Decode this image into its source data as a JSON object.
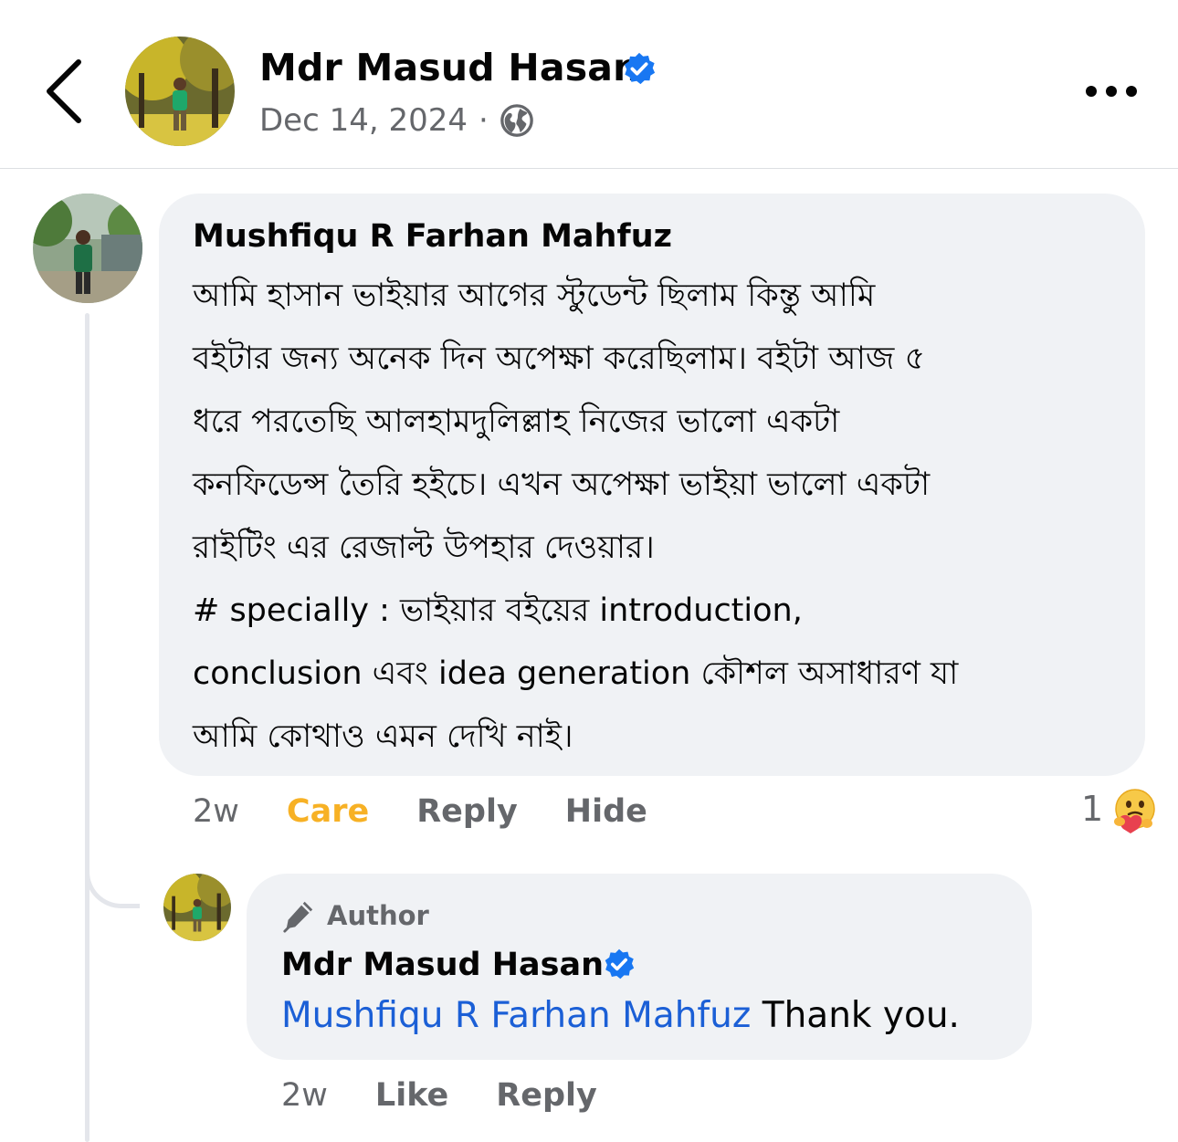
{
  "header": {
    "back_icon": "chevron-left-icon",
    "poster_name": "Mdr Masud Hasan",
    "verified_icon": "verified-badge-icon",
    "post_date": "Dec 14, 2024",
    "separator": "·",
    "privacy_icon": "globe-icon",
    "more_icon": "more-horizontal-icon"
  },
  "comment": {
    "author": "Mushfiqu R Farhan Mahfuz",
    "lines": [
      "আমি হাসান ভাইয়ার আগের স্টুডেন্ট ছিলাম কিন্তু আমি",
      "বইটার জন্য অনেক দিন অপেক্ষা করেছিলাম। বইটা আজ ৫",
      "ধরে পরতেছি আলহামদুলিল্লাহ নিজের ভালো একটা",
      "কনফিডেন্স তৈরি হইচে। এখন অপেক্ষা ভাইয়া ভালো একটা",
      "রাইটিং এর রেজাল্ট উপহার দেওয়ার।",
      "# specially : ভাইয়ার বইয়ের introduction,",
      "conclusion এবং idea generation কৌশল অসাধারণ যা",
      "আমি কোথাও এমন দেখি নাই।"
    ],
    "time": "2w",
    "reaction_label": "Care",
    "reply_label": "Reply",
    "hide_label": "Hide",
    "reaction_count": "1",
    "reaction_icon": "care-emoji-icon"
  },
  "reply": {
    "badge_icon": "pencil-icon",
    "badge_label": "Author",
    "author": "Mdr Masud Hasan",
    "mention": "Mushfiqu R Farhan Mahfuz",
    "text": " Thank you.",
    "time": "2w",
    "like_label": "Like",
    "reply_label": "Reply"
  },
  "colors": {
    "bubble": "#f0f2f5",
    "secondary_text": "#65676b",
    "care": "#f7b125",
    "mention": "#1b5fd6",
    "verified": "#1877f2"
  }
}
